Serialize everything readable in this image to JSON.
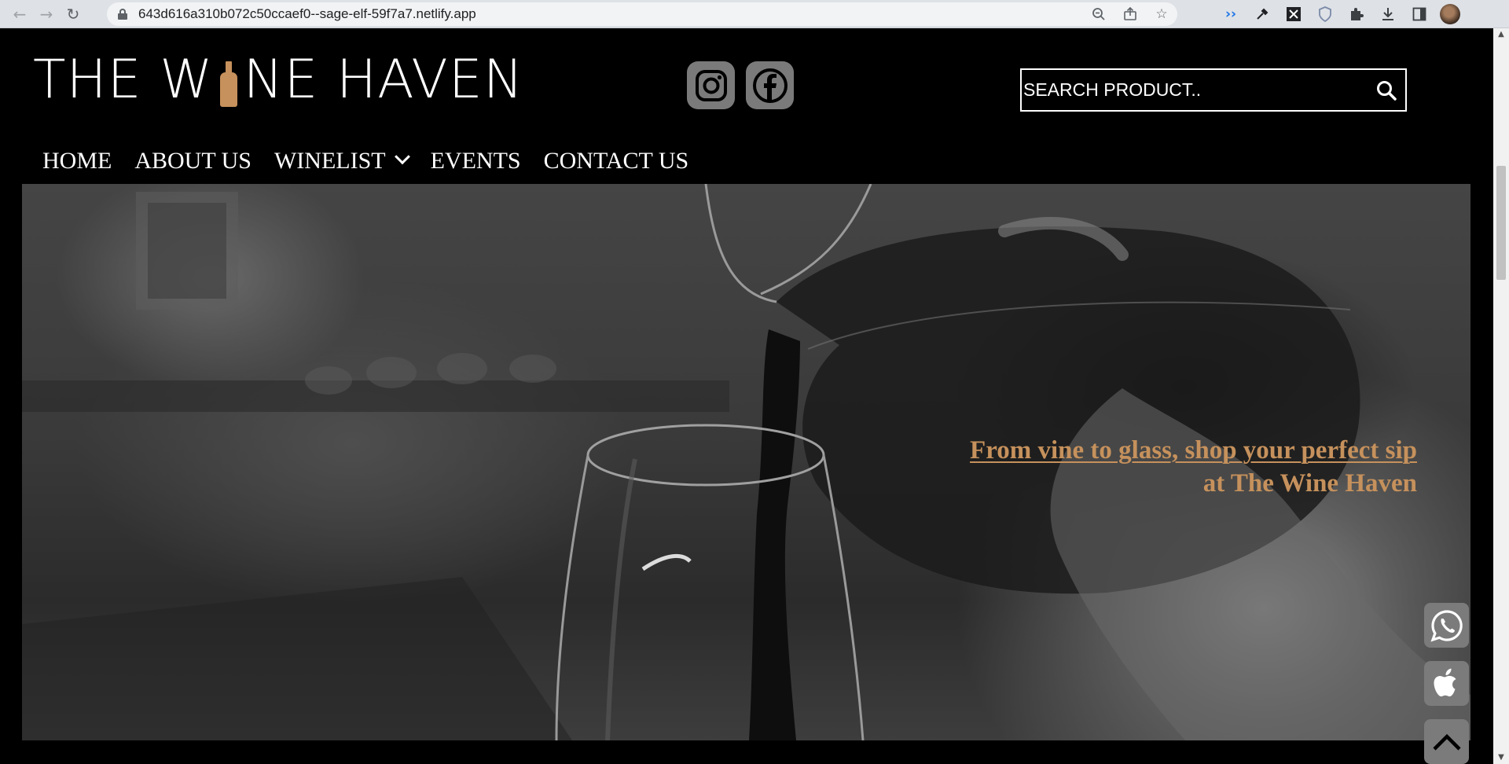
{
  "browser": {
    "url": "643d616a310b072c50ccaef0--sage-elf-59f7a7.netlify.app",
    "nav_icons": [
      "back-arrow-icon",
      "forward-arrow-icon",
      "reload-icon"
    ],
    "omnibox_icons": [
      "zoom-icon",
      "share-icon",
      "bookmark-star-icon"
    ],
    "extension_icons": [
      "read-aloud-icon",
      "eyedropper-icon",
      "excel-icon",
      "shield-icon",
      "puzzle-icon",
      "download-icon",
      "sidepanel-icon",
      "profile-avatar"
    ]
  },
  "header": {
    "logo": {
      "part1": "THE W",
      "part2": "NE HAVEN",
      "accent_color": "#c6915c"
    },
    "social": [
      {
        "name": "instagram-icon"
      },
      {
        "name": "facebook-icon"
      }
    ],
    "search": {
      "placeholder": "SEARCH PRODUCT..",
      "value": ""
    }
  },
  "nav": {
    "items": [
      {
        "label": "HOME"
      },
      {
        "label": "ABOUT US"
      },
      {
        "label": "WINELIST",
        "has_dropdown": true
      },
      {
        "label": "EVENTS"
      },
      {
        "label": "CONTACT US"
      }
    ]
  },
  "hero": {
    "tagline_line1": "From vine to glass, shop your perfect sip",
    "tagline_line2": "at The Wine Haven",
    "tagline_color": "#c6915c"
  },
  "floating_buttons": [
    {
      "name": "whatsapp-icon"
    },
    {
      "name": "apple-icon"
    },
    {
      "name": "scroll-to-top-icon"
    }
  ]
}
